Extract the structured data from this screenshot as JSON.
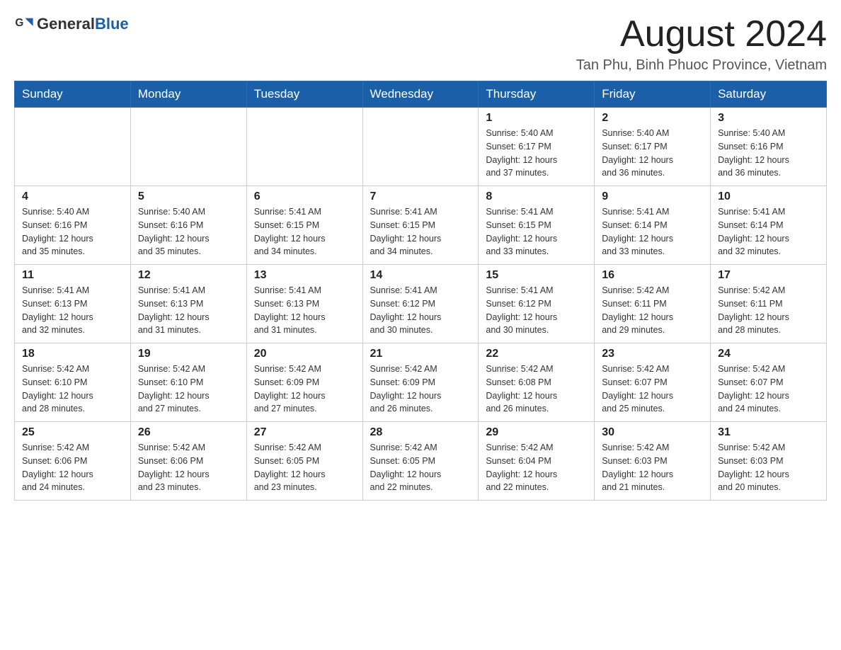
{
  "header": {
    "logo_general": "General",
    "logo_blue": "Blue",
    "month_title": "August 2024",
    "location": "Tan Phu, Binh Phuoc Province, Vietnam"
  },
  "weekdays": [
    "Sunday",
    "Monday",
    "Tuesday",
    "Wednesday",
    "Thursday",
    "Friday",
    "Saturday"
  ],
  "weeks": [
    [
      {
        "day": "",
        "info": ""
      },
      {
        "day": "",
        "info": ""
      },
      {
        "day": "",
        "info": ""
      },
      {
        "day": "",
        "info": ""
      },
      {
        "day": "1",
        "info": "Sunrise: 5:40 AM\nSunset: 6:17 PM\nDaylight: 12 hours\nand 37 minutes."
      },
      {
        "day": "2",
        "info": "Sunrise: 5:40 AM\nSunset: 6:17 PM\nDaylight: 12 hours\nand 36 minutes."
      },
      {
        "day": "3",
        "info": "Sunrise: 5:40 AM\nSunset: 6:16 PM\nDaylight: 12 hours\nand 36 minutes."
      }
    ],
    [
      {
        "day": "4",
        "info": "Sunrise: 5:40 AM\nSunset: 6:16 PM\nDaylight: 12 hours\nand 35 minutes."
      },
      {
        "day": "5",
        "info": "Sunrise: 5:40 AM\nSunset: 6:16 PM\nDaylight: 12 hours\nand 35 minutes."
      },
      {
        "day": "6",
        "info": "Sunrise: 5:41 AM\nSunset: 6:15 PM\nDaylight: 12 hours\nand 34 minutes."
      },
      {
        "day": "7",
        "info": "Sunrise: 5:41 AM\nSunset: 6:15 PM\nDaylight: 12 hours\nand 34 minutes."
      },
      {
        "day": "8",
        "info": "Sunrise: 5:41 AM\nSunset: 6:15 PM\nDaylight: 12 hours\nand 33 minutes."
      },
      {
        "day": "9",
        "info": "Sunrise: 5:41 AM\nSunset: 6:14 PM\nDaylight: 12 hours\nand 33 minutes."
      },
      {
        "day": "10",
        "info": "Sunrise: 5:41 AM\nSunset: 6:14 PM\nDaylight: 12 hours\nand 32 minutes."
      }
    ],
    [
      {
        "day": "11",
        "info": "Sunrise: 5:41 AM\nSunset: 6:13 PM\nDaylight: 12 hours\nand 32 minutes."
      },
      {
        "day": "12",
        "info": "Sunrise: 5:41 AM\nSunset: 6:13 PM\nDaylight: 12 hours\nand 31 minutes."
      },
      {
        "day": "13",
        "info": "Sunrise: 5:41 AM\nSunset: 6:13 PM\nDaylight: 12 hours\nand 31 minutes."
      },
      {
        "day": "14",
        "info": "Sunrise: 5:41 AM\nSunset: 6:12 PM\nDaylight: 12 hours\nand 30 minutes."
      },
      {
        "day": "15",
        "info": "Sunrise: 5:41 AM\nSunset: 6:12 PM\nDaylight: 12 hours\nand 30 minutes."
      },
      {
        "day": "16",
        "info": "Sunrise: 5:42 AM\nSunset: 6:11 PM\nDaylight: 12 hours\nand 29 minutes."
      },
      {
        "day": "17",
        "info": "Sunrise: 5:42 AM\nSunset: 6:11 PM\nDaylight: 12 hours\nand 28 minutes."
      }
    ],
    [
      {
        "day": "18",
        "info": "Sunrise: 5:42 AM\nSunset: 6:10 PM\nDaylight: 12 hours\nand 28 minutes."
      },
      {
        "day": "19",
        "info": "Sunrise: 5:42 AM\nSunset: 6:10 PM\nDaylight: 12 hours\nand 27 minutes."
      },
      {
        "day": "20",
        "info": "Sunrise: 5:42 AM\nSunset: 6:09 PM\nDaylight: 12 hours\nand 27 minutes."
      },
      {
        "day": "21",
        "info": "Sunrise: 5:42 AM\nSunset: 6:09 PM\nDaylight: 12 hours\nand 26 minutes."
      },
      {
        "day": "22",
        "info": "Sunrise: 5:42 AM\nSunset: 6:08 PM\nDaylight: 12 hours\nand 26 minutes."
      },
      {
        "day": "23",
        "info": "Sunrise: 5:42 AM\nSunset: 6:07 PM\nDaylight: 12 hours\nand 25 minutes."
      },
      {
        "day": "24",
        "info": "Sunrise: 5:42 AM\nSunset: 6:07 PM\nDaylight: 12 hours\nand 24 minutes."
      }
    ],
    [
      {
        "day": "25",
        "info": "Sunrise: 5:42 AM\nSunset: 6:06 PM\nDaylight: 12 hours\nand 24 minutes."
      },
      {
        "day": "26",
        "info": "Sunrise: 5:42 AM\nSunset: 6:06 PM\nDaylight: 12 hours\nand 23 minutes."
      },
      {
        "day": "27",
        "info": "Sunrise: 5:42 AM\nSunset: 6:05 PM\nDaylight: 12 hours\nand 23 minutes."
      },
      {
        "day": "28",
        "info": "Sunrise: 5:42 AM\nSunset: 6:05 PM\nDaylight: 12 hours\nand 22 minutes."
      },
      {
        "day": "29",
        "info": "Sunrise: 5:42 AM\nSunset: 6:04 PM\nDaylight: 12 hours\nand 22 minutes."
      },
      {
        "day": "30",
        "info": "Sunrise: 5:42 AM\nSunset: 6:03 PM\nDaylight: 12 hours\nand 21 minutes."
      },
      {
        "day": "31",
        "info": "Sunrise: 5:42 AM\nSunset: 6:03 PM\nDaylight: 12 hours\nand 20 minutes."
      }
    ]
  ]
}
